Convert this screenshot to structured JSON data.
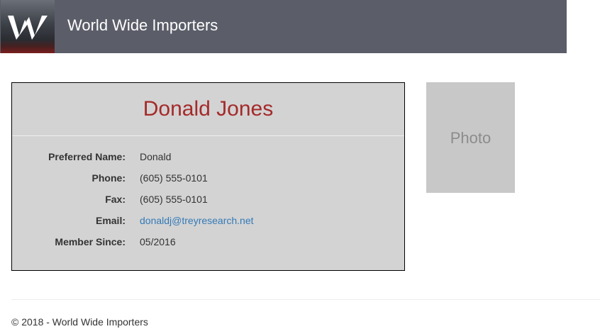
{
  "header": {
    "brand": "World Wide Importers",
    "logo_icon": "westworld-w-logo",
    "background_color": "#5b5e69"
  },
  "profile": {
    "name": "Donald Jones",
    "name_color": "#a52a2a",
    "details": [
      {
        "label": "Preferred Name:",
        "value": "Donald"
      },
      {
        "label": "Phone:",
        "value": "(605) 555-0101"
      },
      {
        "label": "Fax:",
        "value": "(605) 555-0101"
      },
      {
        "label": "Email:",
        "value": "donaldj@treyresearch.net"
      },
      {
        "label": "Member Since:",
        "value": "05/2016"
      }
    ],
    "link_color": "#337ab7"
  },
  "photo": {
    "placeholder": "Photo"
  },
  "footer": {
    "text": "© 2018 - World Wide Importers"
  }
}
